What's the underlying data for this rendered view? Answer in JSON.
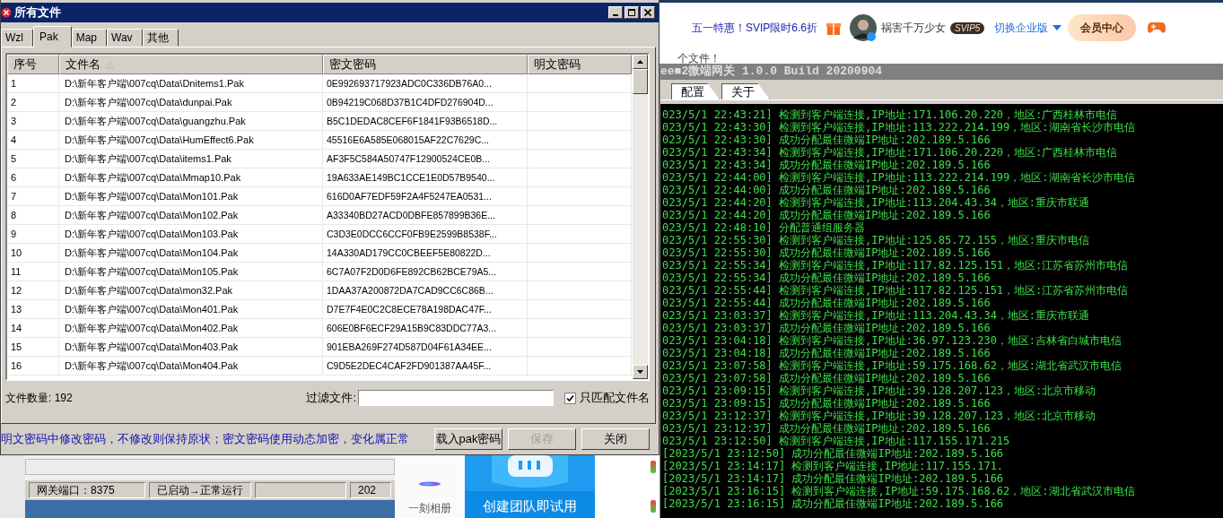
{
  "dialog": {
    "title": "所有文件",
    "tabs": [
      {
        "label": "Wzl",
        "selected": false
      },
      {
        "label": "Pak",
        "selected": true
      },
      {
        "label": "Map",
        "selected": false
      },
      {
        "label": "Wav",
        "selected": false
      },
      {
        "label": "其他",
        "selected": false
      }
    ],
    "table": {
      "columns": [
        {
          "label": "序号",
          "sorted": false
        },
        {
          "label": "文件名",
          "sorted": true
        },
        {
          "label": "密文密码",
          "sorted": false
        },
        {
          "label": "明文密码",
          "sorted": false
        }
      ],
      "rows": [
        [
          "1",
          "D:\\新年客户端\\007cq\\Data\\Dnitems1.Pak",
          "0E992693717923ADC0C336DB76A0..."
        ],
        [
          "2",
          "D:\\新年客户端\\007cq\\Data\\dunpai.Pak",
          "0B94219C068D37B1C4DFD276904D..."
        ],
        [
          "3",
          "D:\\新年客户端\\007cq\\Data\\guangzhu.Pak",
          "B5C1DEDAC8CEF6F1841F93B6518D..."
        ],
        [
          "4",
          "D:\\新年客户端\\007cq\\Data\\HumEffect6.Pak",
          "45516E6A585E068015AF22C7629C..."
        ],
        [
          "5",
          "D:\\新年客户端\\007cq\\Data\\items1.Pak",
          "AF3F5C584A50747F12900524CE0B..."
        ],
        [
          "6",
          "D:\\新年客户端\\007cq\\Data\\Mmap10.Pak",
          "19A633AE149BC1CCE1E0D57B9540..."
        ],
        [
          "7",
          "D:\\新年客户端\\007cq\\Data\\Mon101.Pak",
          "616D0AF7EDF59F2A4F5247EA0531..."
        ],
        [
          "8",
          "D:\\新年客户端\\007cq\\Data\\Mon102.Pak",
          "A33340BD27ACD0DBFE857899B36E..."
        ],
        [
          "9",
          "D:\\新年客户端\\007cq\\Data\\Mon103.Pak",
          "C3D3E0DCC6CCF0FB9E2599B8538F..."
        ],
        [
          "10",
          "D:\\新年客户端\\007cq\\Data\\Mon104.Pak",
          "14A330AD179CC0CBEEF5E80822D..."
        ],
        [
          "11",
          "D:\\新年客户端\\007cq\\Data\\Mon105.Pak",
          "6C7A07F2D0D6FE892CB62BCE79A5..."
        ],
        [
          "12",
          "D:\\新年客户端\\007cq\\Data\\mon32.Pak",
          "1DAA37A200872DA7CAD9CC6C86B..."
        ],
        [
          "13",
          "D:\\新年客户端\\007cq\\Data\\Mon401.Pak",
          "D7E7F4E0C2C8ECE78A198DAC47F..."
        ],
        [
          "14",
          "D:\\新年客户端\\007cq\\Data\\Mon402.Pak",
          "606E0BF6ECF29A15B9C83DDC77A3..."
        ],
        [
          "15",
          "D:\\新年客户端\\007cq\\Data\\Mon403.Pak",
          "901EBA269F274D587D04F61A34EE..."
        ],
        [
          "16",
          "D:\\新年客户端\\007cq\\Data\\Mon404.Pak",
          "C9D5E2DEC4CAF2FD901387AA45F..."
        ]
      ]
    },
    "file_count": "文件数量: 192",
    "filter_label": "过滤文件:",
    "match_option": {
      "label": "只匹配文件名",
      "checked": true
    },
    "hint": "明文密码中修改密码，不修改则保持原状；密文密码使用动态加密，变化属正常",
    "buttons": [
      {
        "label": "载入pak密码",
        "disabled": false
      },
      {
        "label": "保存",
        "disabled": true
      },
      {
        "label": "关闭",
        "disabled": false
      }
    ]
  },
  "background_window": {
    "status_bar": [
      "网关端口：8375",
      "已启动→正常运行",
      "202"
    ]
  },
  "album_app": {
    "label": "一刻相册"
  },
  "promo": {
    "text": "创建团队即试用"
  },
  "browser_header": {
    "promo_link": "五一特惠！SVIP限时6.6折",
    "username": "祸害千万少女",
    "vip_badge": "SVIP5",
    "switch_label": "切换企业版",
    "member_button": "会员中心"
  },
  "page_fragment": "个文件！",
  "gateway_window": {
    "title": "ee■2微端网关 1.0.0 Build 20200904",
    "tabs": [
      {
        "label": "配置",
        "selected": false
      },
      {
        "label": "关于",
        "selected": false
      }
    ],
    "log": [
      "023/5/1 22:43:21] 检测到客户端连接,IP地址:171.106.20.220，地区:广西桂林市电信",
      "023/5/1 22:43:30] 检测到客户端连接,IP地址:113.222.214.199，地区:湖南省长沙市电信",
      "023/5/1 22:43:30] 成功分配最佳微端IP地址:202.189.5.166",
      "023/5/1 22:43:34] 检测到客户端连接,IP地址:171.106.20.220，地区:广西桂林市电信",
      "023/5/1 22:43:34] 成功分配最佳微端IP地址:202.189.5.166",
      "023/5/1 22:44:00] 检测到客户端连接,IP地址:113.222.214.199，地区:湖南省长沙市电信",
      "023/5/1 22:44:00] 成功分配最佳微端IP地址:202.189.5.166",
      "023/5/1 22:44:20] 检测到客户端连接,IP地址:113.204.43.34，地区:重庆市联通",
      "023/5/1 22:44:20] 成功分配最佳微端IP地址:202.189.5.166",
      "023/5/1 22:48:10] 分配普通组服务器",
      "023/5/1 22:55:30] 检测到客户端连接,IP地址:125.85.72.155，地区:重庆市电信",
      "023/5/1 22:55:30] 成功分配最佳微端IP地址:202.189.5.166",
      "023/5/1 22:55:34] 检测到客户端连接,IP地址:117.82.125.151，地区:江苏省苏州市电信",
      "023/5/1 22:55:34] 成功分配最佳微端IP地址:202.189.5.166",
      "023/5/1 22:55:44] 检测到客户端连接,IP地址:117.82.125.151，地区:江苏省苏州市电信",
      "023/5/1 22:55:44] 成功分配最佳微端IP地址:202.189.5.166",
      "023/5/1 23:03:37] 检测到客户端连接,IP地址:113.204.43.34，地区:重庆市联通",
      "023/5/1 23:03:37] 成功分配最佳微端IP地址:202.189.5.166",
      "023/5/1 23:04:18] 检测到客户端连接,IP地址:36.97.123.230，地区:吉林省白城市电信",
      "023/5/1 23:04:18] 成功分配最佳微端IP地址:202.189.5.166",
      "023/5/1 23:07:58] 检测到客户端连接,IP地址:59.175.168.62，地区:湖北省武汉市电信",
      "023/5/1 23:07:58] 成功分配最佳微端IP地址:202.189.5.166",
      "023/5/1 23:09:15] 检测到客户端连接,IP地址:39.128.207.123，地区:北京市移动",
      "023/5/1 23:09:15] 成功分配最佳微端IP地址:202.189.5.166",
      "023/5/1 23:12:37] 检测到客户端连接,IP地址:39.128.207.123，地区:北京市移动",
      "023/5/1 23:12:37] 成功分配最佳微端IP地址:202.189.5.166",
      "023/5/1 23:12:50] 检测到客户端连接,IP地址:117.155.171.215",
      "[2023/5/1 23:12:50] 成功分配最佳微端IP地址:202.189.5.166",
      "[2023/5/1 23:14:17] 检测到客户端连接,IP地址:117.155.171.",
      "[2023/5/1 23:14:17] 成功分配最佳微端IP地址:202.189.5.166",
      "[2023/5/1 23:16:15] 检测到客户端连接,IP地址:59.175.168.62，地区:湖北省武汉市电信",
      "[2023/5/1 23:16:15] 成功分配最佳微端IP地址:202.189.5.166"
    ]
  }
}
